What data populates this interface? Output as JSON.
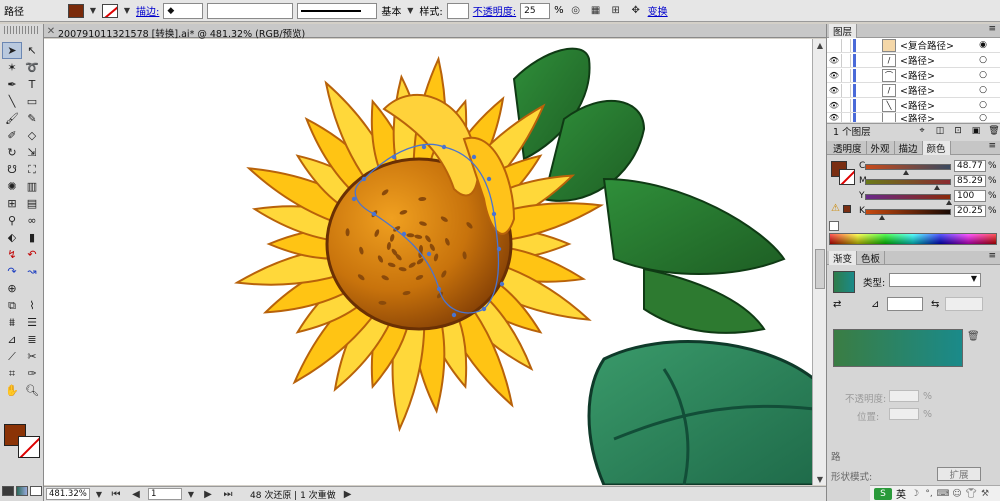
{
  "control_bar": {
    "selection_label": "路径",
    "fill_color": "#7a2a0a",
    "stroke_label": "描边:",
    "stroke_profile": "基本",
    "style_label": "样式:",
    "opacity_label": "不透明度:",
    "opacity_value": "25",
    "opacity_unit": "%",
    "transform_label": "变换"
  },
  "document": {
    "title": "200791011321578 [转换].ai* @ 481.32% (RGB/预览)"
  },
  "tools": {
    "fill_color": "#8b3306",
    "items": [
      "selection",
      "direct-selection",
      "magic-wand",
      "lasso",
      "pen",
      "type",
      "line",
      "rectangle",
      "paintbrush",
      "pencil",
      "blob-brush",
      "eraser",
      "rotate",
      "scale",
      "warp",
      "free-transform",
      "symbol-sprayer",
      "graph",
      "mesh",
      "gradient",
      "eyedropper",
      "blend",
      "live-paint",
      "live-paint-select",
      "artboard",
      "slice",
      "hand",
      "zoom"
    ]
  },
  "status": {
    "zoom": "481.32%",
    "page": "1",
    "history": "48 次还原 | 1 次重做"
  },
  "layers_panel": {
    "tab": "图层",
    "rows": [
      {
        "name": "<复合路径>",
        "visible": false
      },
      {
        "name": "<路径>",
        "visible": true
      },
      {
        "name": "<路径>",
        "visible": true
      },
      {
        "name": "<路径>",
        "visible": true
      },
      {
        "name": "<路径>",
        "visible": true
      },
      {
        "name": "<路径>",
        "visible": true
      }
    ],
    "footer": "1 个图层"
  },
  "color_panel": {
    "tabs": [
      "透明度",
      "外观",
      "描边",
      "颜色"
    ],
    "active_tab": "颜色",
    "fill_color": "#7a2e12",
    "channels": [
      {
        "label": "C",
        "value": "48.77",
        "position": 0.4877
      },
      {
        "label": "M",
        "value": "85.29",
        "position": 0.8529
      },
      {
        "label": "Y",
        "value": "100",
        "position": 1.0
      },
      {
        "label": "K",
        "value": "20.25",
        "position": 0.2025
      }
    ],
    "unit": "%"
  },
  "gradient_panel": {
    "tabs": [
      "渐变",
      "色板"
    ],
    "active_tab": "渐变",
    "type_label": "类型:",
    "opacity_label": "不透明度:",
    "position_label": "位置:",
    "unit": "%",
    "start_color": "#3a7d43",
    "end_color": "#1a8a8a"
  },
  "bottom_panel": {
    "label1": "路",
    "label2": "形状模式:",
    "expand_button": "扩展"
  },
  "ime": {
    "logo": "S",
    "lang": "英"
  }
}
